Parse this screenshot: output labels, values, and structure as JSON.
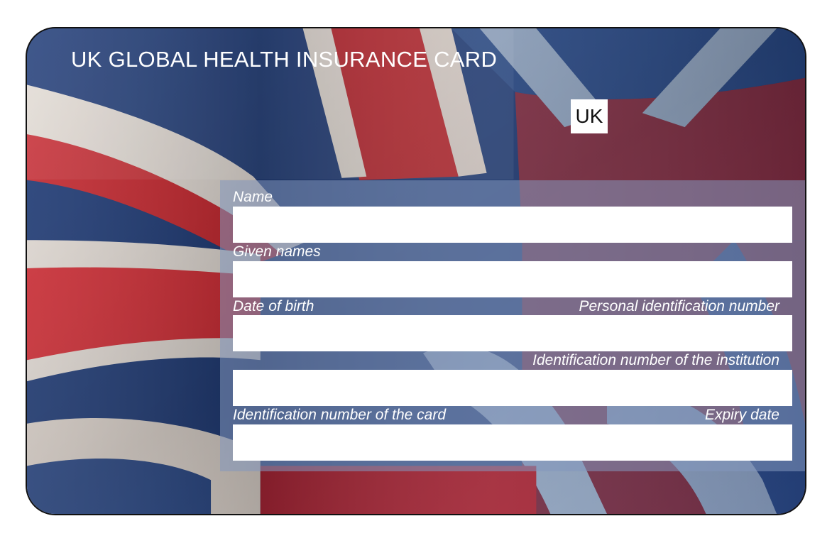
{
  "card": {
    "title": "UK GLOBAL HEALTH INSURANCE CARD",
    "country_code": "UK"
  },
  "fields": {
    "name_label": "Name",
    "given_names_label": "Given names",
    "date_of_birth_label": "Date of birth",
    "personal_id_label": "Personal identification number",
    "institution_id_label": "Identification number of the institution",
    "card_id_label": "Identification number of the card",
    "expiry_date_label": "Expiry date"
  },
  "colors": {
    "flag_blue": "#1c3a78",
    "flag_red": "#d42a32",
    "flag_white": "#f1e9e2",
    "panel_overlay": "#8498be"
  }
}
